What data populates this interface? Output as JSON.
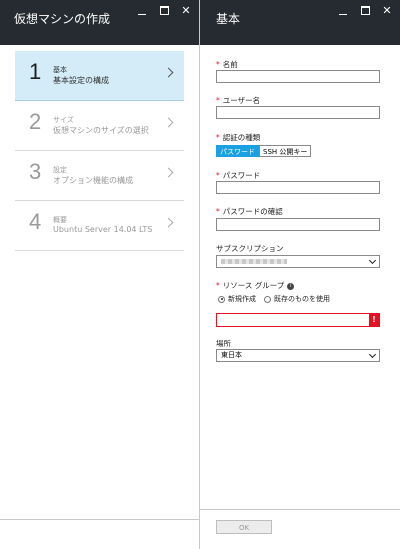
{
  "left_blade": {
    "title": "仮想マシンの作成",
    "steps": [
      {
        "number": "1",
        "title": "基本",
        "subtitle": "基本設定の構成",
        "active": true
      },
      {
        "number": "2",
        "title": "サイズ",
        "subtitle": "仮想マシンのサイズの選択",
        "active": false
      },
      {
        "number": "3",
        "title": "設定",
        "subtitle": "オプション機能の構成",
        "active": false
      },
      {
        "number": "4",
        "title": "概要",
        "subtitle": "Ubuntu Server 14.04 LTS",
        "active": false
      }
    ]
  },
  "right_blade": {
    "title": "基本",
    "required_mark": "*",
    "fields": {
      "name_label": "名前",
      "username_label": "ユーザー名",
      "auth_type_label": "認証の種類",
      "auth_options": [
        "パスワード",
        "SSH 公開キー"
      ],
      "auth_selected": "パスワード",
      "password_label": "パスワード",
      "password_confirm_label": "パスワードの確認",
      "subscription_label": "サブスクリプション",
      "resource_group_label": "リソース グループ",
      "rg_options": [
        "新規作成",
        "既存のものを使用"
      ],
      "rg_selected": "新規作成",
      "error_mark": "!",
      "location_label": "場所",
      "location_value": "東日本"
    },
    "ok_label": "OK"
  },
  "colors": {
    "header_bg": "#252b31",
    "active_step_bg": "#d3ecf8",
    "accent": "#1ba1e2",
    "error": "#e81123"
  }
}
